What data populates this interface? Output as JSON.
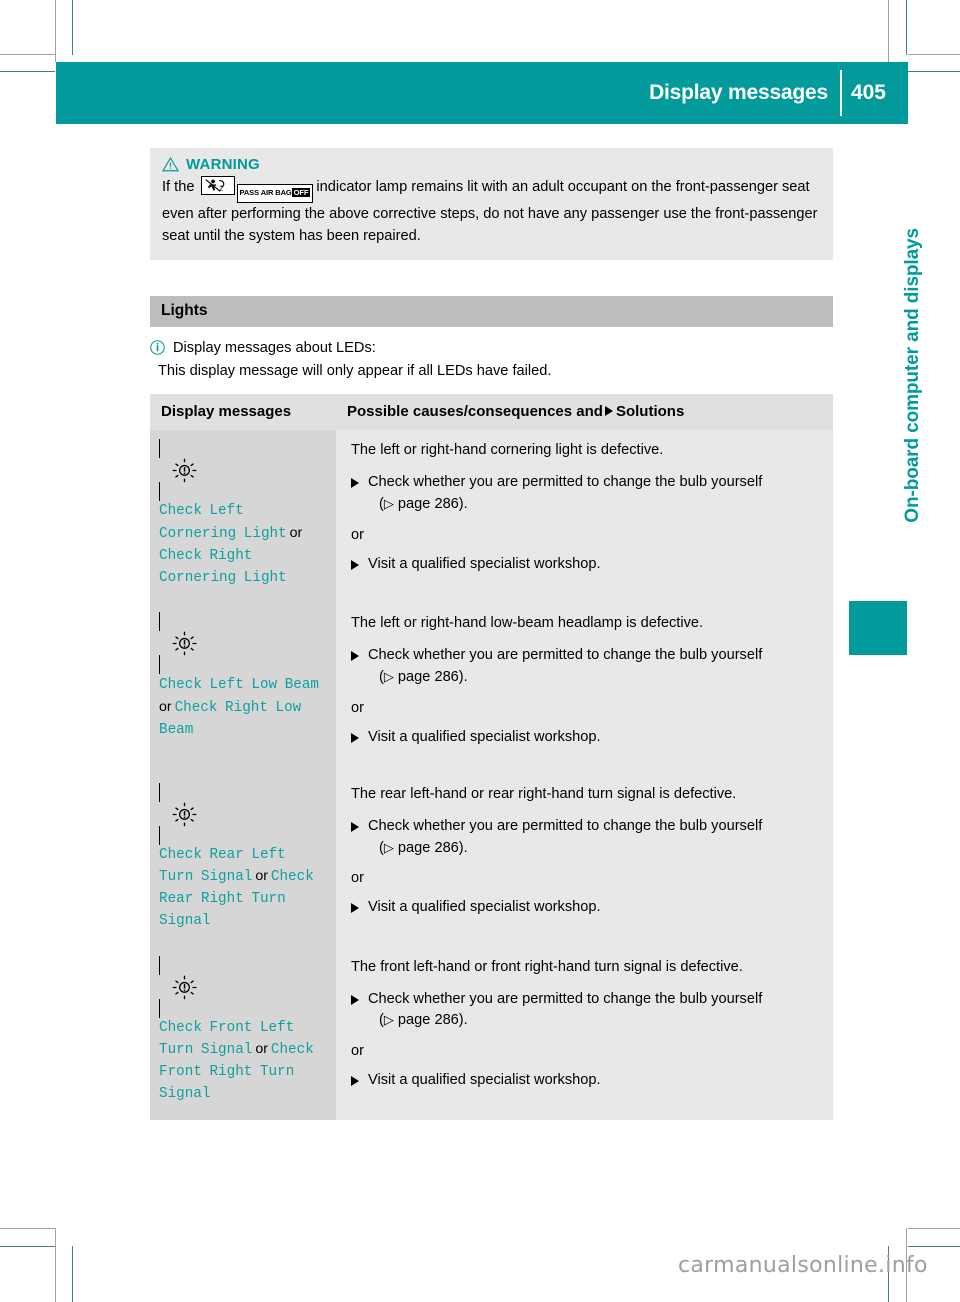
{
  "header": {
    "title": "Display messages",
    "page_number": "405"
  },
  "side": {
    "chapter_label": "On-board computer and displays"
  },
  "warning": {
    "icon": "warning-triangle-icon",
    "title": "WARNING",
    "text_before": "If the",
    "icon_airbag": "passenger-airbag-person-icon",
    "icon_badge_text": "PASS AIR BAG",
    "icon_badge_state": "OFF",
    "text_after": "indicator lamp remains lit with an adult occupant on the front-passenger seat even after performing the above corrective steps, do not have any passenger use the front-passenger seat until the system has been repaired."
  },
  "section": {
    "title": "Lights"
  },
  "note": {
    "icon": "info-icon",
    "line1": "Display messages about LEDs:",
    "line2": "This display message will only appear if all LEDs have failed."
  },
  "table": {
    "headers": {
      "col1": "Display messages",
      "col2_before": "Possible causes/consequences and",
      "col2_after": "Solutions"
    },
    "rows": [
      {
        "icon": "bulb-fault-icon",
        "message_parts": [
          {
            "type": "msg",
            "text": "Check Left Cornering Light"
          },
          {
            "type": "or",
            "text": "or"
          },
          {
            "type": "msg",
            "text": "Check Right Cornering Light"
          }
        ],
        "cause": "The left or right-hand cornering light is defective.",
        "step1": "Check whether you are permitted to change the bulb yourself",
        "step1_ref": "page 286).",
        "or_text": "or",
        "step2": "Visit a qualified specialist workshop."
      },
      {
        "icon": "bulb-fault-icon",
        "message_parts": [
          {
            "type": "msg",
            "text": "Check Left Low Beam"
          },
          {
            "type": "or",
            "text": "or"
          },
          {
            "type": "msg",
            "text": "Check Right Low Beam"
          }
        ],
        "cause": "The left or right-hand low-beam headlamp is defective.",
        "step1": "Check whether you are permitted to change the bulb yourself",
        "step1_ref": "page 286).",
        "or_text": "or",
        "step2": "Visit a qualified specialist workshop."
      },
      {
        "icon": "bulb-fault-icon",
        "message_parts": [
          {
            "type": "msg",
            "text": "Check Rear Left Turn Signal"
          },
          {
            "type": "or",
            "text": "or"
          },
          {
            "type": "msg",
            "text": "Check Rear Right Turn Signal"
          }
        ],
        "cause": "The rear left-hand or rear right-hand turn signal is defective.",
        "step1": "Check whether you are permitted to change the bulb yourself",
        "step1_ref": "page 286).",
        "or_text": "or",
        "step2": "Visit a qualified specialist workshop."
      },
      {
        "icon": "bulb-fault-icon",
        "message_parts": [
          {
            "type": "msg",
            "text": "Check Front Left Turn Signal"
          },
          {
            "type": "or",
            "text": "or"
          },
          {
            "type": "msg",
            "text": "Check Front Right Turn Signal"
          }
        ],
        "cause": "The front left-hand or front right-hand turn signal is defective.",
        "step1": "Check whether you are permitted to change the bulb yourself",
        "step1_ref": "page 286).",
        "or_text": "or",
        "step2": "Visit a qualified specialist workshop."
      }
    ]
  },
  "watermark": {
    "text": "carmanualsonline.info"
  },
  "colors": {
    "accent_teal": "#029a9a",
    "message_teal": "#0f9f9f",
    "section_gray": "#bdbdbd",
    "table_col1_gray": "#d6d6d6",
    "table_col2_gray": "#e8e8e8"
  }
}
